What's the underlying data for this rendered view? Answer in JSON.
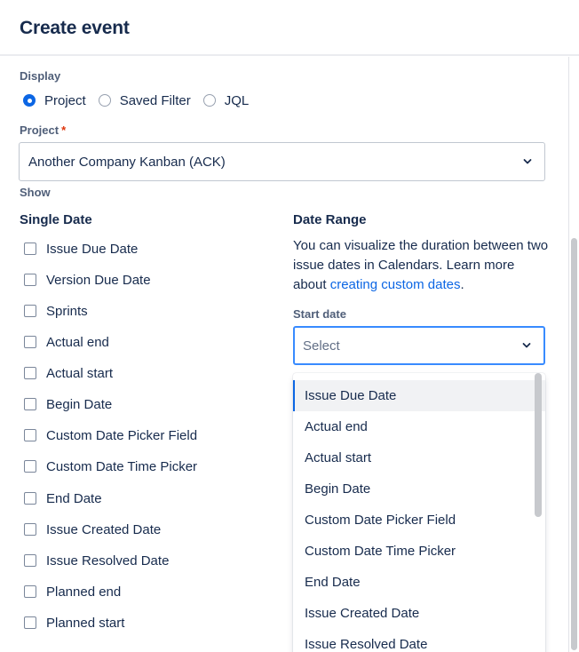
{
  "dialog": {
    "title": "Create event"
  },
  "display": {
    "label": "Display",
    "options": [
      "Project",
      "Saved Filter",
      "JQL"
    ],
    "selected": "Project"
  },
  "project": {
    "label": "Project",
    "required_mark": "*",
    "value": "Another Company Kanban (ACK)"
  },
  "show": {
    "label": "Show"
  },
  "single_date": {
    "heading": "Single Date",
    "items": [
      "Issue Due Date",
      "Version Due Date",
      "Sprints",
      "Actual end",
      "Actual start",
      "Begin Date",
      "Custom Date Picker Field",
      "Custom Date Time Picker",
      "End Date",
      "Issue Created Date",
      "Issue Resolved Date",
      "Planned end",
      "Planned start"
    ]
  },
  "date_range": {
    "heading": "Date Range",
    "description": "You can visualize the duration between two issue dates in Calendars. Learn more about",
    "link_text": "creating custom dates",
    "description_end": ".",
    "start_date_label": "Start date",
    "start_date_placeholder": "Select",
    "dropdown_options": [
      "Issue Due Date",
      "Actual end",
      "Actual start",
      "Begin Date",
      "Custom Date Picker Field",
      "Custom Date Time Picker",
      "End Date",
      "Issue Created Date",
      "Issue Resolved Date"
    ],
    "highlighted_option": "Issue Due Date"
  },
  "colors": {
    "accent": "#0c66e4",
    "focus_border": "#388bff",
    "text": "#172b4d",
    "required": "#de350b"
  },
  "icons": {
    "select_chevron": "chevron-down-icon"
  }
}
